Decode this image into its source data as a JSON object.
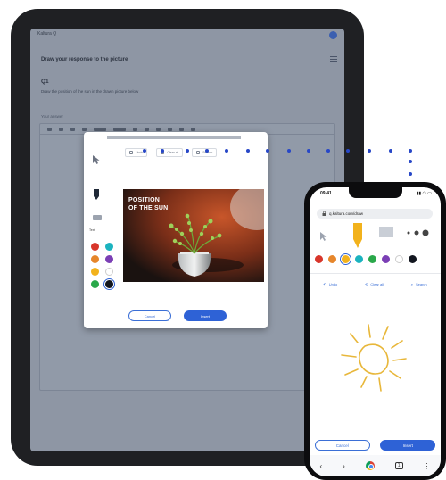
{
  "colors": {
    "accent": "#2e62d6",
    "connector": "#2747c7",
    "tablet_overlay": "#8e96a4"
  },
  "tablet": {
    "app_label": "Kaltura Q",
    "page_title": "Draw your response to the picture",
    "question_number": "Q1",
    "question_text": "Draw the position of the sun in the drawn picture below",
    "answer_label": "Your answer",
    "toolbar_icons": [
      "undo-icon",
      "redo-icon",
      "bold-icon",
      "italic-icon",
      "underline-icon",
      "align-icon",
      "link-icon",
      "image-icon",
      "table-icon",
      "code-icon"
    ]
  },
  "modal": {
    "tabs": [
      {
        "label": "Undo",
        "icon": "undo-icon"
      },
      {
        "label": "Clear all",
        "icon": "trash-icon"
      },
      {
        "label": "Search",
        "icon": "search-icon"
      }
    ],
    "tool_text_label": "Text",
    "image_caption_line1": "POSITION",
    "image_caption_line2": "OF THE SUN",
    "palette": [
      "#d8362b",
      "#1bb3bf",
      "#e6862b",
      "#7b3fb5",
      "#f2b21c",
      "#ffffff",
      "#2aa84a",
      "#12161f"
    ],
    "cancel_label": "Cancel",
    "insert_label": "Insert"
  },
  "phone": {
    "time": "09:41",
    "status": "▮▮ ◠ ▭",
    "url": "q.kaltura.com/draw",
    "palette": [
      "#d8362b",
      "#e6862b",
      "#f2b21c",
      "#1bb3bf",
      "#2aa84a",
      "#7b3fb5",
      "#ffffff",
      "#12161f"
    ],
    "undo_label": "Undo",
    "clear_label": "Clear all",
    "search_label": "Search",
    "cancel_label": "Cancel",
    "insert_label": "Insert",
    "nav": {
      "back": "‹",
      "forward": "›",
      "tabs": "1",
      "more": "⋮"
    }
  }
}
